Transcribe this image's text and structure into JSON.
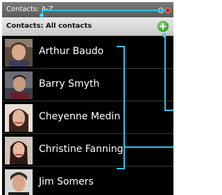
{
  "status_bar": {
    "title": "Contacts: A-Z"
  },
  "header": {
    "label": "Contacts: All contacts",
    "add_icon": "plus-icon",
    "add_glyph": "+"
  },
  "contacts": [
    {
      "name": "Arthur Baudo"
    },
    {
      "name": "Barry Smyth"
    },
    {
      "name": "Cheyenne Medin"
    },
    {
      "name": "Christine Fanning"
    },
    {
      "name": "Jim Somers"
    }
  ],
  "colors": {
    "callout": "#2ec4ea",
    "add_button": "#3a9a2a",
    "notification_dot": "#c81e1e"
  }
}
